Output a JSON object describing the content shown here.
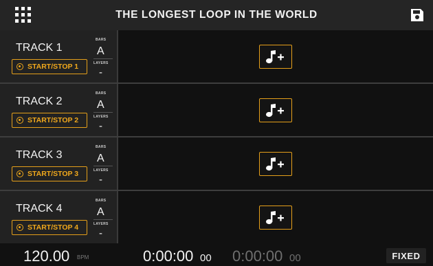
{
  "header": {
    "title": "THE LONGEST LOOP IN THE WORLD",
    "menu_icon": "grid-menu-icon",
    "save_icon": "floppy-save-icon"
  },
  "labels": {
    "bars": "BARS",
    "layers": "LAYERS"
  },
  "tracks": [
    {
      "name": "TRACK 1",
      "start_stop": "START/STOP 1",
      "bars": "A",
      "layers": "-"
    },
    {
      "name": "TRACK 2",
      "start_stop": "START/STOP 2",
      "bars": "A",
      "layers": "-"
    },
    {
      "name": "TRACK 3",
      "start_stop": "START/STOP 3",
      "bars": "A",
      "layers": "-"
    },
    {
      "name": "TRACK 4",
      "start_stop": "START/STOP 4",
      "bars": "A",
      "layers": "-"
    }
  ],
  "add_icon": "music-note-plus-icon",
  "footer": {
    "bpm": "120.00",
    "bpm_label": "BPM",
    "time_main": "0:00:00",
    "time_main_small": "00",
    "time_secondary": "0:00:00",
    "time_secondary_small": "00",
    "mode": "FIXED"
  },
  "colors": {
    "accent": "#f0a81c",
    "background": "#111111",
    "panel": "#222222"
  }
}
